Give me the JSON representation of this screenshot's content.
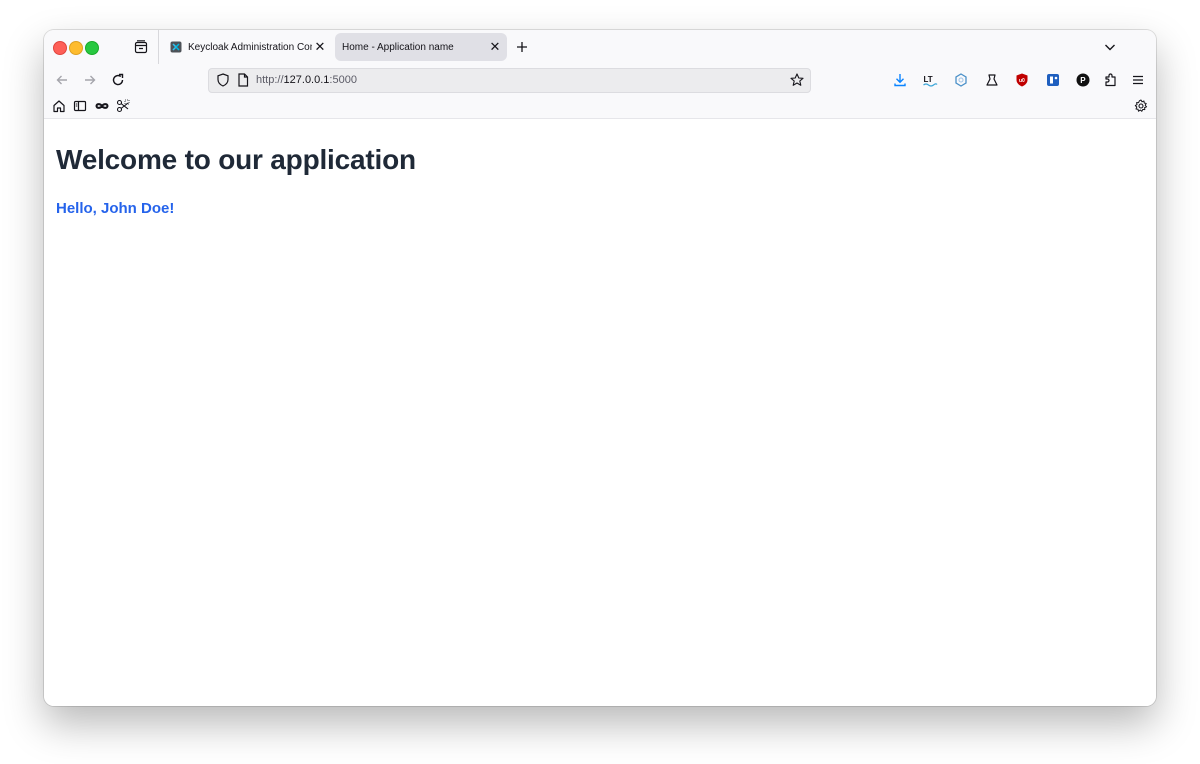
{
  "browser": {
    "tabs": [
      {
        "title": "Keycloak Administration Console",
        "active": false
      },
      {
        "title": "Home - Application name",
        "active": true
      }
    ],
    "url": {
      "scheme": "http://",
      "host": "127.0.0.1",
      "port": ":5000"
    },
    "toolbar_icons": [
      "back-arrow-icon",
      "forward-arrow-icon",
      "reload-icon",
      "shield-icon",
      "page-icon",
      "bookmark-star-icon",
      "download-icon",
      "languagetool-icon",
      "extension-hex-icon",
      "extension-person-icon",
      "ublock-icon",
      "extension-blue-icon",
      "extension-p-icon",
      "extensions-puzzle-icon",
      "menu-icon"
    ],
    "bookmark_icons": [
      "home-icon",
      "sidebar-icon",
      "infinity-icon",
      "scissors-icon"
    ],
    "colors": {
      "accent_blue": "#2563eb",
      "heading": "#1f2937",
      "ublock_red": "#c00000"
    }
  },
  "page": {
    "heading": "Welcome to our application",
    "greeting": "Hello, John Doe!"
  }
}
